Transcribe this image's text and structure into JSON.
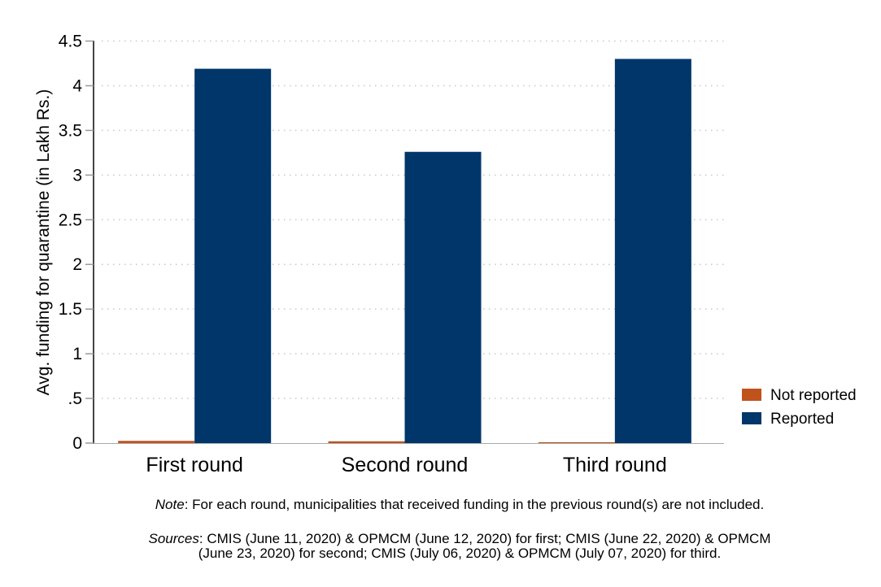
{
  "chart_data": {
    "type": "bar",
    "title": "",
    "xlabel": "",
    "ylabel": "Avg. funding for quarantine (in Lakh Rs.)",
    "ylim": [
      0,
      4.5
    ],
    "yticks": [
      0,
      0.5,
      1,
      1.5,
      2,
      2.5,
      3,
      3.5,
      4,
      4.5
    ],
    "ytick_labels": [
      "0",
      ".5",
      "1",
      "1.5",
      "2",
      "2.5",
      "3",
      "3.5",
      "4",
      "4.5"
    ],
    "grid": true,
    "legend_position": "right",
    "categories": [
      "First round",
      "Second round",
      "Third round"
    ],
    "series": [
      {
        "name": "Not reported",
        "color": "#c0521c",
        "values": [
          0.025,
          0.02,
          0.01
        ]
      },
      {
        "name": "Reported",
        "color": "#01366a",
        "values": [
          4.19,
          3.26,
          4.3
        ]
      }
    ]
  },
  "note": {
    "label": "Note",
    "text": ": For each round, municipalities that received funding in the previous round(s) are not included."
  },
  "sources": {
    "label": "Sources",
    "line1": ": CMIS (June 11, 2020) & OPMCM (June 12, 2020) for first; CMIS (June 22, 2020) & OPMCM",
    "line2": "(June 23, 2020) for second; CMIS (July 06, 2020) & OPMCM (July 07, 2020) for third."
  }
}
